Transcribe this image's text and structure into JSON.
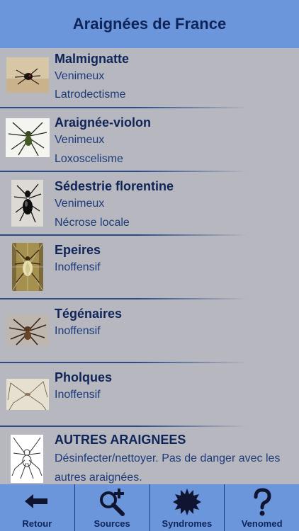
{
  "header": {
    "title": "Araignées de France"
  },
  "spiders": [
    {
      "name": "Malmignatte",
      "line1": "Venimeux",
      "line2": "Latrodectisme",
      "icon": "malmignatte-photo"
    },
    {
      "name": "Araignée-violon",
      "line1": "Venimeux",
      "line2": "Loxoscelisme",
      "icon": "violin-spider-photo"
    },
    {
      "name": "Sédestrie florentine",
      "line1": "Venimeux",
      "line2": "Nécrose locale",
      "icon": "segestria-photo"
    },
    {
      "name": "Epeires",
      "line1": "Inoffensif",
      "icon": "orb-weaver-photo"
    },
    {
      "name": "Tégénaires",
      "line1": "Inoffensif",
      "icon": "house-spider-photo"
    },
    {
      "name": "Pholques",
      "line1": "Inoffensif",
      "icon": "cellar-spider-photo"
    },
    {
      "name": "AUTRES ARAIGNEES",
      "desc": "Désinfecter/nettoyer. Pas de danger avec les autres araignées.",
      "icon": "spider-outline-drawing"
    }
  ],
  "tabs": [
    {
      "label": "Retour",
      "icon": "back-arrow-icon"
    },
    {
      "label": "Sources",
      "icon": "search-plus-icon"
    },
    {
      "label": "Syndromes",
      "icon": "starburst-icon"
    },
    {
      "label": "Venomed",
      "icon": "question-mark-icon"
    }
  ],
  "colors": {
    "bar": "#6c96db",
    "background": "#b7b8bf",
    "title_text": "#0f2458",
    "body_text": "#1c3a7a"
  }
}
